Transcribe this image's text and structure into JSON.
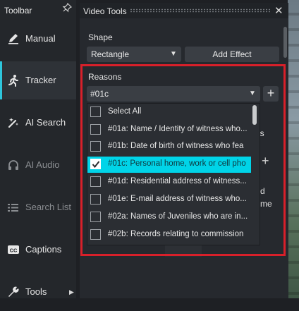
{
  "toolbar": {
    "title": "Toolbar",
    "pin_icon": "pin-icon",
    "items": [
      {
        "label": "Manual",
        "icon": "pencil-icon",
        "active": false,
        "disabled": false
      },
      {
        "label": "Tracker",
        "icon": "running-person-icon",
        "active": true,
        "disabled": false
      },
      {
        "label": "AI Search",
        "icon": "magic-wand-icon",
        "active": false,
        "disabled": false
      },
      {
        "label": "AI Audio",
        "icon": "headphones-icon",
        "active": false,
        "disabled": true
      },
      {
        "label": "Search List",
        "icon": "list-icon",
        "active": false,
        "disabled": true
      },
      {
        "label": "Captions",
        "icon": "cc-icon",
        "active": false,
        "disabled": false
      },
      {
        "label": "Tools",
        "icon": "wrench-icon",
        "active": false,
        "disabled": false
      }
    ]
  },
  "panel": {
    "title": "Video Tools",
    "close_icon": "close-icon",
    "shape": {
      "label": "Shape",
      "value": "Rectangle"
    },
    "add_effect_label": "Add Effect",
    "background_controls": {
      "button_fragment": "ns",
      "text_d": "d",
      "text_e": "me"
    },
    "reasons": {
      "label": "Reasons",
      "value": "#01c",
      "options": [
        {
          "text": "Select All",
          "checked": false,
          "highlighted": false
        },
        {
          "text": "#01a: Name / Identity of witness who...",
          "checked": false,
          "highlighted": false
        },
        {
          "text": "#01b: Date of birth of witness who fea",
          "checked": false,
          "highlighted": false
        },
        {
          "text": "#01c: Personal home, work or cell pho",
          "checked": true,
          "highlighted": true
        },
        {
          "text": "#01d: Residential address of witness...",
          "checked": false,
          "highlighted": false
        },
        {
          "text": "#01e: E-mail address of witness who...",
          "checked": false,
          "highlighted": false
        },
        {
          "text": "#02a: Names of Juveniles who are in...",
          "checked": false,
          "highlighted": false
        },
        {
          "text": "#02b: Records relating to commission",
          "checked": false,
          "highlighted": false
        }
      ]
    }
  },
  "colors": {
    "accent": "#2ec6dc",
    "selection": "#00d4e8",
    "highlight_border": "#d8202a",
    "panel_bg": "#26292e",
    "toolbar_bg": "#24272b"
  }
}
